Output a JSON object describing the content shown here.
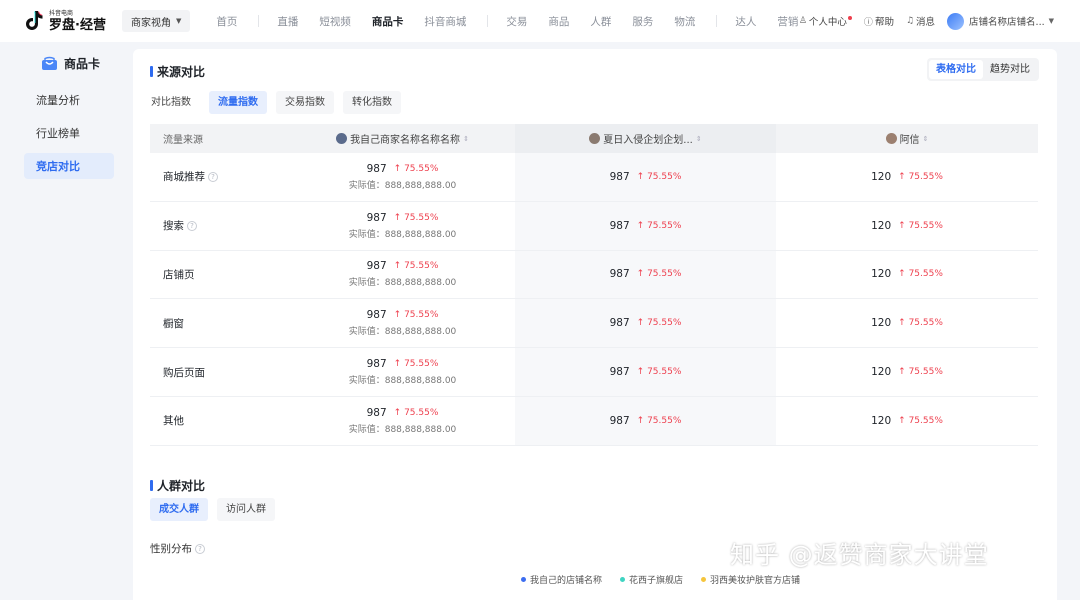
{
  "brand": {
    "small": "抖音电商",
    "big": "罗盘·经营"
  },
  "perspective": "商家视角",
  "nav": {
    "group1": [
      "首页"
    ],
    "group2": [
      "直播",
      "短视频",
      "商品卡",
      "抖音商城"
    ],
    "group3": [
      "交易",
      "商品",
      "人群",
      "服务",
      "物流"
    ],
    "group4": [
      "达人",
      "营销"
    ],
    "active": "商品卡"
  },
  "rightnav": {
    "personal": "个人中心",
    "help": "帮助",
    "messages": "消息",
    "store": "店铺名称店铺名..."
  },
  "sidebar": {
    "title": "商品卡",
    "items": [
      {
        "label": "流量分析"
      },
      {
        "label": "行业榜单"
      },
      {
        "label": "竞店对比"
      }
    ],
    "active_index": 2
  },
  "source_compare": {
    "title": "来源对比",
    "view_toggle": [
      "表格对比",
      "趋势对比"
    ],
    "tabs": [
      "对比指数",
      "流量指数",
      "交易指数",
      "转化指数"
    ],
    "active_tab": 1,
    "table": {
      "header": {
        "source": "流量来源",
        "columns": [
          "我自己商家名称名称名称",
          "夏日入侵企划企划...",
          "阿信"
        ]
      },
      "actual_label": "实际值：",
      "rows": [
        {
          "source": "商城推荐",
          "help": true,
          "own": {
            "value": "987",
            "delta": "75.55%",
            "actual": "888,888,888.00"
          },
          "c2": {
            "value": "987",
            "delta": "75.55%"
          },
          "c3": {
            "value": "120",
            "delta": "75.55%"
          }
        },
        {
          "source": "搜索",
          "help": true,
          "own": {
            "value": "987",
            "delta": "75.55%",
            "actual": "888,888,888.00"
          },
          "c2": {
            "value": "987",
            "delta": "75.55%"
          },
          "c3": {
            "value": "120",
            "delta": "75.55%"
          }
        },
        {
          "source": "店铺页",
          "help": false,
          "own": {
            "value": "987",
            "delta": "75.55%",
            "actual": "888,888,888.00"
          },
          "c2": {
            "value": "987",
            "delta": "75.55%"
          },
          "c3": {
            "value": "120",
            "delta": "75.55%"
          }
        },
        {
          "source": "橱窗",
          "help": false,
          "own": {
            "value": "987",
            "delta": "75.55%",
            "actual": "888,888,888.00"
          },
          "c2": {
            "value": "987",
            "delta": "75.55%"
          },
          "c3": {
            "value": "120",
            "delta": "75.55%"
          }
        },
        {
          "source": "购后页面",
          "help": false,
          "own": {
            "value": "987",
            "delta": "75.55%",
            "actual": "888,888,888.00"
          },
          "c2": {
            "value": "987",
            "delta": "75.55%"
          },
          "c3": {
            "value": "120",
            "delta": "75.55%"
          }
        },
        {
          "source": "其他",
          "help": false,
          "own": {
            "value": "987",
            "delta": "75.55%",
            "actual": "888,888,888.00"
          },
          "c2": {
            "value": "987",
            "delta": "75.55%"
          },
          "c3": {
            "value": "120",
            "delta": "75.55%"
          }
        }
      ]
    }
  },
  "crowd_compare": {
    "title": "人群对比",
    "tabs": [
      "成交人群",
      "访问人群"
    ],
    "active_tab": 0,
    "gender_label": "性别分布",
    "legend": [
      {
        "label": "我自己的店铺名称",
        "color": "#3c6df0"
      },
      {
        "label": "花西子旗舰店",
        "color": "#3fd4c2"
      },
      {
        "label": "羽西美妆护肤官方店铺",
        "color": "#f5c53d"
      }
    ]
  },
  "watermark": "知乎 @返赞商家大讲堂",
  "colors": {
    "accent": "#2f6cf0",
    "up": "#ee3f4d"
  }
}
